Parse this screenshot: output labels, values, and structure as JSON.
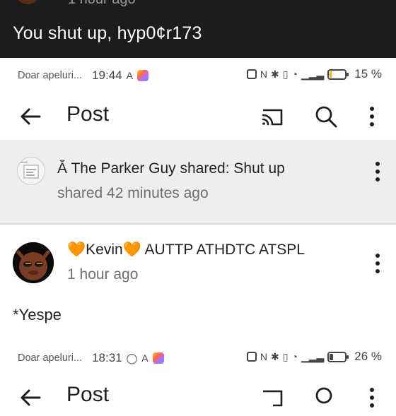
{
  "previous": {
    "time": "1 hour ago",
    "comment": "You shut up, hyp0¢r173"
  },
  "status_bar_1": {
    "carrier": "Doar apeluri...",
    "time": "19:44",
    "battery_pct": "15 %",
    "battery_level": 0.15,
    "battery_color": "#f2b100"
  },
  "app_bar": {
    "title": "Post",
    "icons": [
      "back-arrow-icon",
      "cast-icon",
      "search-icon",
      "more-vertical-icon"
    ]
  },
  "shared": {
    "user": "Ă The Parker Guy shared:",
    "title": "Shut up",
    "time": "shared 42 minutes ago"
  },
  "comment": {
    "heart_left": "🧡",
    "name": "Kevin",
    "heart_right": "🧡",
    "tags": "AUTTP ATHDTC ATSPL",
    "time": "1 hour ago",
    "body": "*Yespe"
  },
  "status_bar_2": {
    "carrier": "Doar apeluri...",
    "time": "18:31",
    "battery_pct": "26 %",
    "battery_level": 0.26,
    "battery_color": "#444444"
  },
  "app_bar_2": {
    "title": "Post"
  }
}
